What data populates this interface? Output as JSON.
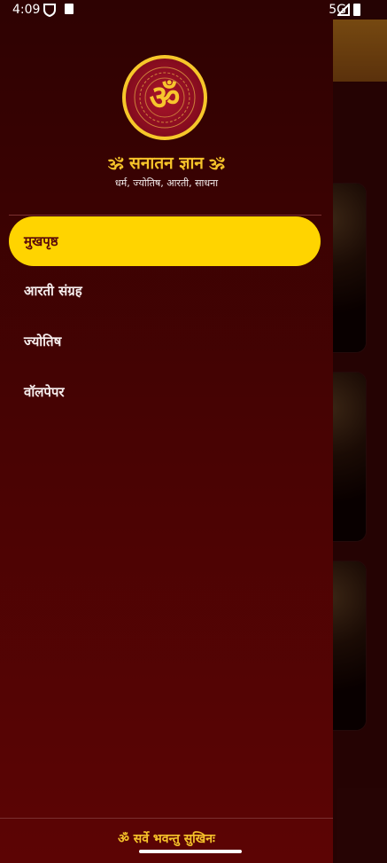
{
  "status_bar": {
    "time": "4:09",
    "network": "5G"
  },
  "drawer": {
    "logo_symbol": "ॐ",
    "title": "🕉 सनातन ज्ञान 🕉",
    "subtitle": "धर्म, ज्योतिष, आरती, साधना",
    "menu": [
      {
        "label": "मुखपृष्ठ",
        "active": true
      },
      {
        "label": "आरती संग्रह",
        "active": false
      },
      {
        "label": "ज्योतिष",
        "active": false
      },
      {
        "label": "वॉलपेपर",
        "active": false
      }
    ],
    "footer": "ॐ सर्वे भवन्तु सुखिनः"
  },
  "colors": {
    "accent": "#ffd400",
    "gold_text": "#f6c42a",
    "drawer_bg": "#3a0303"
  },
  "icons": [
    "security-shield-icon",
    "sd-card-icon",
    "signal-icon",
    "battery-icon",
    "om-mandala-logo"
  ]
}
